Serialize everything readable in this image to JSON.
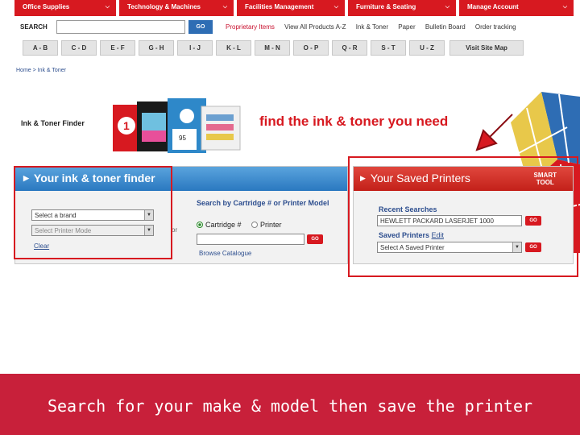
{
  "nav": {
    "tabs": [
      "Office Supplies",
      "Technology & Machines",
      "Facilities Management",
      "Furniture & Seating",
      "Manage Account"
    ]
  },
  "search": {
    "label": "SEARCH",
    "value": "",
    "go": "GO",
    "links": [
      "Proprietary Items",
      "View All Products A-Z",
      "Ink & Toner",
      "Paper",
      "Bulletin Board",
      "Order tracking"
    ]
  },
  "alphabet": [
    "A - B",
    "C - D",
    "E - F",
    "G - H",
    "I - J",
    "K - L",
    "M - N",
    "O - P",
    "Q - R",
    "S - T",
    "U - Z"
  ],
  "sitemap": "Visit Site Map",
  "breadcrumb": "Home > Ink & Toner",
  "promo": {
    "finder_title": "Ink & Toner Finder",
    "headline": "find the ink & toner you need"
  },
  "finder": {
    "title": "Your ink & toner finder",
    "brand_select": "Select a brand",
    "model_select": "Select Printer Mode",
    "clear": "Clear",
    "or": "or",
    "cartridge_heading": "Search by Cartridge # or Printer Model",
    "radio_cartridge": "Cartridge #",
    "radio_printer": "Printer",
    "cartridge_value": "",
    "go": "GO",
    "browse": "Browse Catalogue"
  },
  "saved": {
    "title": "Your Saved Printers",
    "smart_line1": "SMART",
    "smart_line2": "TOOL",
    "recent_label": "Recent Searches",
    "recent_value": "HEWLETT PACKARD LASERJET 1000",
    "saved_label": "Saved Printers",
    "edit": "Edit",
    "saved_select": "Select A Saved Printer",
    "go": "GO"
  },
  "caption": "Search for your make & model then save the printer",
  "colors": {
    "brand_red": "#d71920",
    "finder_blue": "#2a78c0",
    "caption_bg": "#c8203a"
  }
}
